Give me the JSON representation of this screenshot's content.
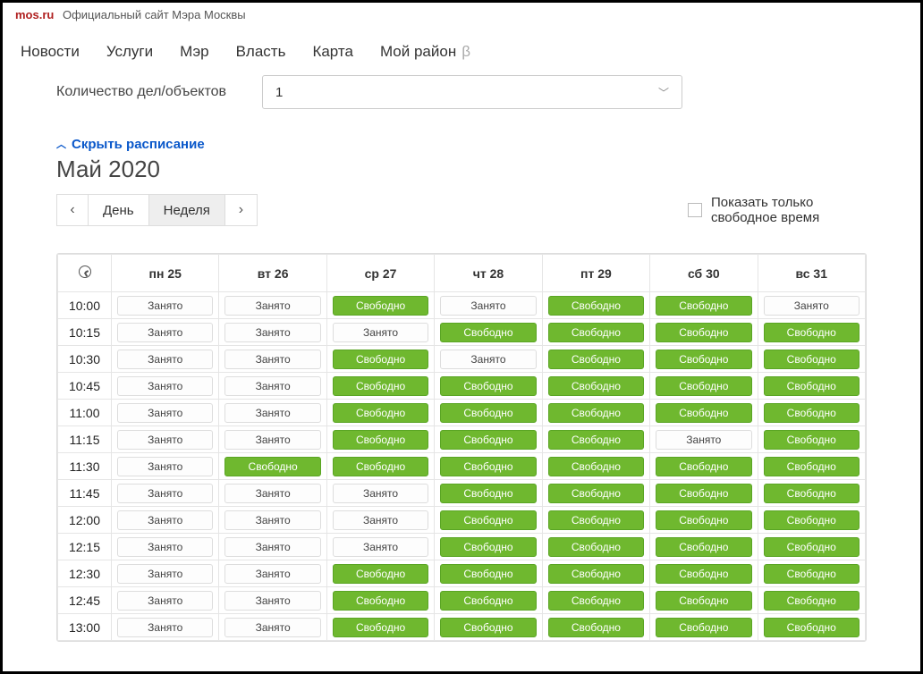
{
  "top": {
    "brand": "mos.ru",
    "slogan": "Официальный сайт Мэра Москвы"
  },
  "nav": {
    "items": [
      "Новости",
      "Услуги",
      "Мэр",
      "Власть",
      "Карта",
      "Мой район"
    ],
    "beta": "β"
  },
  "filter": {
    "label": "Количество дел/объектов",
    "value": "1"
  },
  "toggle": "Скрыть расписание",
  "month": "Май 2020",
  "seg": {
    "day": "День",
    "week": "Неделя"
  },
  "show_free": "Показать только свободное время",
  "status": {
    "busy": "Занято",
    "free": "Свободно"
  },
  "days": [
    "пн 25",
    "вт 26",
    "ср 27",
    "чт 28",
    "пт 29",
    "сб 30",
    "вс 31"
  ],
  "times": [
    "10:00",
    "10:15",
    "10:30",
    "10:45",
    "11:00",
    "11:15",
    "11:30",
    "11:45",
    "12:00",
    "12:15",
    "12:30",
    "12:45",
    "13:00"
  ],
  "slots": [
    [
      "b",
      "b",
      "f",
      "b",
      "f",
      "f",
      "b"
    ],
    [
      "b",
      "b",
      "b",
      "f",
      "f",
      "f",
      "f"
    ],
    [
      "b",
      "b",
      "f",
      "b",
      "f",
      "f",
      "f"
    ],
    [
      "b",
      "b",
      "f",
      "f",
      "f",
      "f",
      "f"
    ],
    [
      "b",
      "b",
      "f",
      "f",
      "f",
      "f",
      "f"
    ],
    [
      "b",
      "b",
      "f",
      "f",
      "f",
      "b",
      "f"
    ],
    [
      "b",
      "f",
      "f",
      "f",
      "f",
      "f",
      "f"
    ],
    [
      "b",
      "b",
      "b",
      "f",
      "f",
      "f",
      "f"
    ],
    [
      "b",
      "b",
      "b",
      "f",
      "f",
      "f",
      "f"
    ],
    [
      "b",
      "b",
      "b",
      "f",
      "f",
      "f",
      "f"
    ],
    [
      "b",
      "b",
      "f",
      "f",
      "f",
      "f",
      "f"
    ],
    [
      "b",
      "b",
      "f",
      "f",
      "f",
      "f",
      "f"
    ],
    [
      "b",
      "b",
      "f",
      "f",
      "f",
      "f",
      "f"
    ]
  ]
}
